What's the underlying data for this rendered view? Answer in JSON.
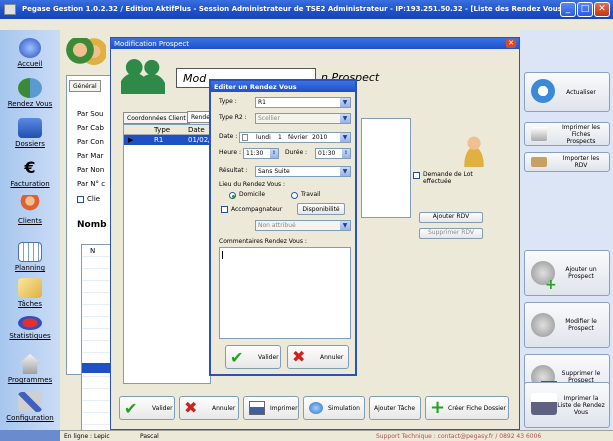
{
  "window": {
    "title": "Pegase Gestion 1.0.2.32 / Edition AktifPlus - Session Administrateur de TSE2 Administrateur - IP:193.251.50.32 - [Liste des Rendez Vous]"
  },
  "nav": [
    "Accueil",
    "Rendez Vous",
    "Dossiers",
    "Facturation",
    "Clients",
    "Planning",
    "Tâches",
    "Statistiques",
    "Programmes",
    "Configuration"
  ],
  "search_panel": {
    "tab": "Général",
    "items": [
      "Par Sou",
      "Par Cab",
      "Par Con",
      "Par Mar",
      "Par Non",
      "Par N° c"
    ],
    "checkbox_label": "Clie",
    "nombre_label": "Nomb",
    "col_header": "N"
  },
  "prospect_modal": {
    "title": "Modification Prospect",
    "heading": "Mod",
    "heading_rest": "n Prospect",
    "tabs": [
      "Coordonnées Client",
      "Rendez"
    ],
    "table_headers": [
      "Type",
      "Date et I"
    ],
    "row": {
      "type": "R1",
      "date": "01/02/2"
    },
    "demande_label": "Demande de Lot effectuée",
    "add_rdv": "Ajouter RDV",
    "del_rdv": "Supprimer RDV",
    "footer": {
      "valider": "Valider",
      "annuler": "Annuler",
      "imprimer": "Imprimer",
      "simulation": "Simulation",
      "ajouter_tache": "Ajouter Tâche",
      "creer_fiche": "Créer Fiche Dossier"
    }
  },
  "dialog": {
    "title": "Editer un Rendez Vous",
    "type_label": "Type :",
    "type_value": "R1",
    "type2_label": "Type R2 :",
    "type2_value": "Scellier",
    "date_label": "Date :",
    "date_day": "lundi",
    "date_num": "1",
    "date_month": "février",
    "date_year": "2010",
    "heure_label": "Heure :",
    "heure_value": "11:30",
    "duree_label": "Durée :",
    "duree_value": "01:30",
    "resultat_label": "Résultat :",
    "resultat_value": "Sans Suite",
    "lieu_label": "Lieu du Rendez Vous :",
    "domicile": "Domicile",
    "travail": "Travail",
    "accompagnateur": "Accompagnateur",
    "disponibilite": "Disponibilité",
    "non_attribue": "Non attribué",
    "commentaires_label": "Commentaires Rendez Vous :",
    "valider": "Valider",
    "annuler": "Annuler"
  },
  "right_panel": {
    "actualiser": "Actualiser",
    "imprimer_fiches": "Imprimer les Fiches Prospects",
    "importer_rdv": "Importer les RDV",
    "ajouter_prospect": "Ajouter un Prospect",
    "modifier_prospect": "Modifier le Prospect",
    "supprimer_prospect": "Supprimer le Prospect",
    "imprimer_liste": "Imprimer la Liste de Rendez Vous"
  },
  "status": {
    "left": "En ligne : Lepic",
    "middle": "Pascal",
    "right": "Support Technique : contact@pegasy.fr / 0892 43 6006"
  },
  "colors": {
    "title_blue": "#1f50c4",
    "accent_green": "#24a024",
    "cancel_red": "#d02020"
  }
}
